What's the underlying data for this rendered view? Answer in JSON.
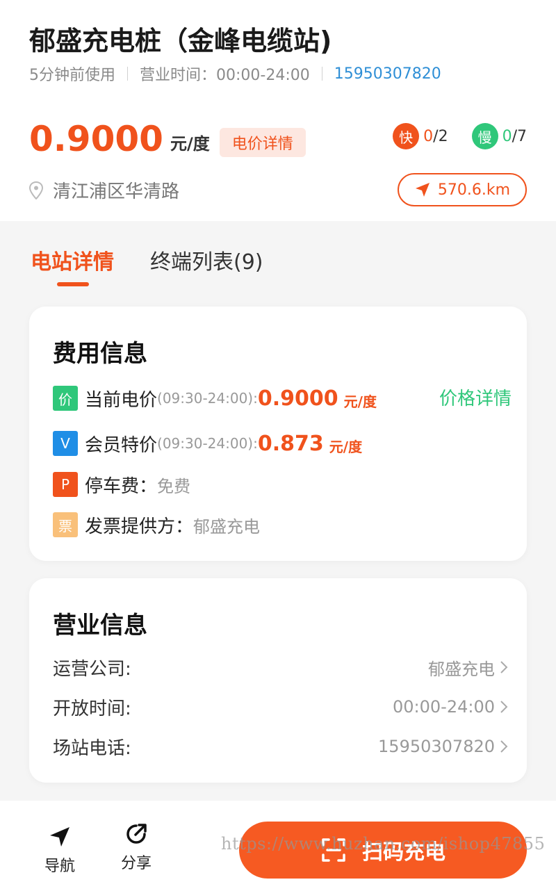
{
  "station": {
    "title": "郁盛充电桩（金峰电缆站)",
    "last_used": "5分钟前使用",
    "hours_label": "营业时间：00:00-24:00",
    "phone": "15950307820",
    "price": "0.9000",
    "price_unit": "元/度",
    "price_detail_label": "电价详情",
    "fast": {
      "label": "快",
      "available": "0",
      "total": "/2"
    },
    "slow": {
      "label": "慢",
      "available": "0",
      "total": "/7"
    },
    "address": "清江浦区华清路",
    "distance": "570.6.km"
  },
  "tabs": [
    {
      "label": "电站详情",
      "active": true
    },
    {
      "label": "终端列表(9)",
      "active": false
    }
  ],
  "fee_info": {
    "title": "费用信息",
    "price_link": "价格详情",
    "rows": [
      {
        "icon": "价",
        "label": "当前电价",
        "time": "(09:30-24:00):",
        "price": "0.9000",
        "unit": "元/度"
      },
      {
        "icon": "V",
        "label": "会员特价",
        "time": "(09:30-24:00):",
        "price": "0.873",
        "unit": "元/度"
      },
      {
        "icon": "P",
        "label": "停车费：",
        "value": "免费"
      },
      {
        "icon": "票",
        "label": "发票提供方：",
        "value": "郁盛充电"
      }
    ]
  },
  "business_info": {
    "title": "营业信息",
    "rows": [
      {
        "label": "运营公司:",
        "value": "郁盛充电"
      },
      {
        "label": "开放时间:",
        "value": "00:00-24:00"
      },
      {
        "label": "场站电话:",
        "value": "15950307820"
      }
    ]
  },
  "bottom_bar": {
    "nav_label": "导航",
    "share_label": "分享",
    "scan_label": "扫码充电"
  },
  "watermark": "https://www.huzhan.com/ishop47855",
  "colors": {
    "accent": "#f0521c",
    "green": "#2fc77a",
    "blue": "#2f8fd6",
    "vip_blue": "#1f8ee6",
    "parking_red": "#f0521c",
    "invoice_yellow": "#f9c07a"
  }
}
